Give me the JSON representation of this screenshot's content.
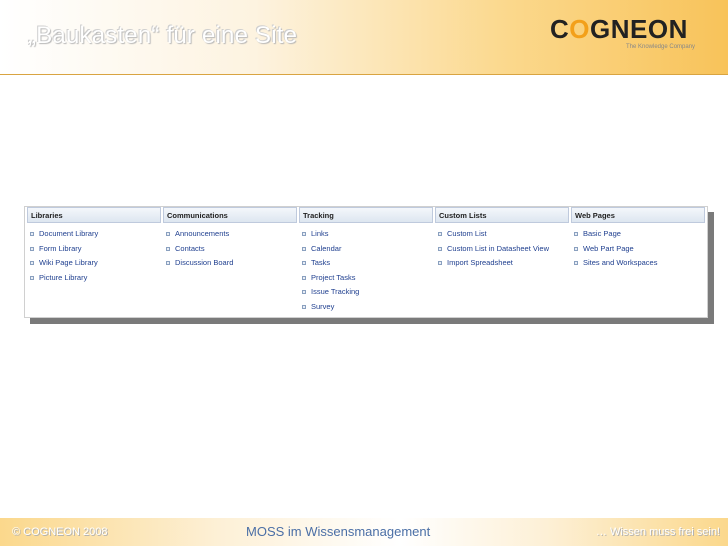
{
  "header": {
    "title": "„Baukasten“ für eine Site",
    "logo_text_1": "C",
    "logo_text_2": "O",
    "logo_text_3": "GNEON",
    "tagline": "The Knowledge Company"
  },
  "panel": {
    "columns": [
      {
        "heading": "Libraries",
        "items": [
          "Document Library",
          "Form Library",
          "Wiki Page Library",
          "Picture Library"
        ]
      },
      {
        "heading": "Communications",
        "items": [
          "Announcements",
          "Contacts",
          "Discussion Board"
        ]
      },
      {
        "heading": "Tracking",
        "items": [
          "Links",
          "Calendar",
          "Tasks",
          "Project Tasks",
          "Issue Tracking",
          "Survey"
        ]
      },
      {
        "heading": "Custom Lists",
        "items": [
          "Custom List",
          "Custom List in Datasheet View",
          "Import Spreadsheet"
        ]
      },
      {
        "heading": "Web Pages",
        "items": [
          "Basic Page",
          "Web Part Page",
          "Sites and Workspaces"
        ]
      }
    ]
  },
  "footer": {
    "left": "© COGNEON 2008",
    "center": "MOSS im Wissensmanagement",
    "right": "… Wissen muss frei sein!"
  }
}
